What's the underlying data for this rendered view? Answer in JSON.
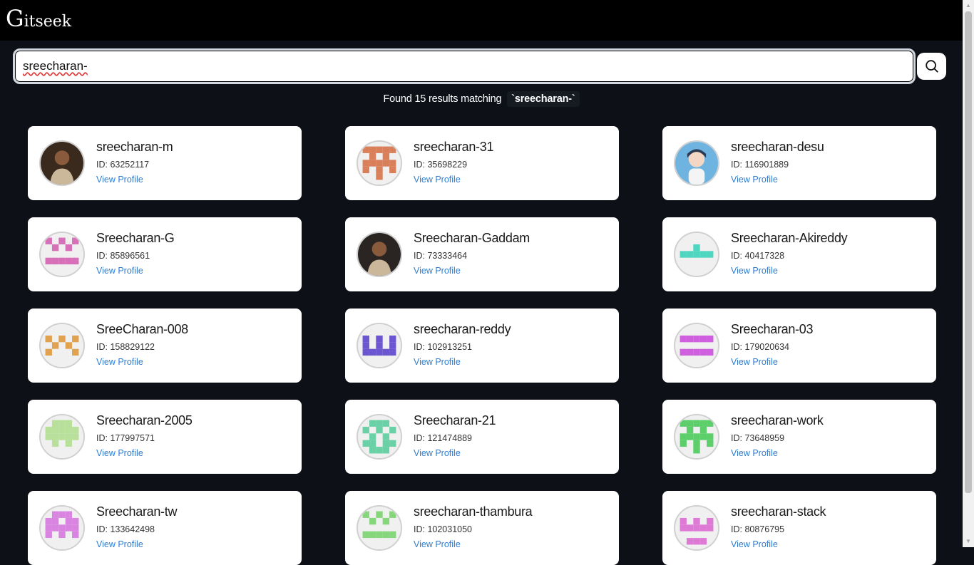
{
  "app": {
    "logo_initial": "G",
    "logo_rest": "itseek"
  },
  "search": {
    "value": "sreecharan-",
    "button_icon": "search-icon"
  },
  "results": {
    "prefix": "Found 15 results matching",
    "query": "`sreecharan-`"
  },
  "labels": {
    "view_profile": "View Profile"
  },
  "users": [
    {
      "name": "sreecharan-m",
      "id": "ID: 63252117",
      "avatar": "photo",
      "color": "#3a2a1e"
    },
    {
      "name": "sreecharan-31",
      "id": "ID: 35698229",
      "avatar": "identicon",
      "color": "#d9805a"
    },
    {
      "name": "sreecharan-desu",
      "id": "ID: 116901889",
      "avatar": "anime",
      "color": "#6fb4e0"
    },
    {
      "name": "Sreecharan-G",
      "id": "ID: 85896561",
      "avatar": "identicon",
      "color": "#d770b8"
    },
    {
      "name": "Sreecharan-Gaddam",
      "id": "ID: 73333464",
      "avatar": "photo",
      "color": "#2a2522"
    },
    {
      "name": "Sreecharan-Akireddy",
      "id": "ID: 40417328",
      "avatar": "identicon",
      "color": "#4fd6c1"
    },
    {
      "name": "SreeCharan-008",
      "id": "ID: 158829122",
      "avatar": "identicon",
      "color": "#e0a24e"
    },
    {
      "name": "sreecharan-reddy",
      "id": "ID: 102913251",
      "avatar": "identicon",
      "color": "#6b55d1"
    },
    {
      "name": "Sreecharan-03",
      "id": "ID: 179020634",
      "avatar": "identicon",
      "color": "#d05fe0"
    },
    {
      "name": "Sreecharan-2005",
      "id": "ID: 177997571",
      "avatar": "identicon",
      "color": "#b8e09a"
    },
    {
      "name": "Sreecharan-21",
      "id": "ID: 121474889",
      "avatar": "identicon",
      "color": "#6ad0a6"
    },
    {
      "name": "sreecharan-work",
      "id": "ID: 73648959",
      "avatar": "identicon",
      "color": "#5ccf6a"
    },
    {
      "name": "Sreecharan-tw",
      "id": "ID: 133642498",
      "avatar": "identicon",
      "color": "#d984e0"
    },
    {
      "name": "sreecharan-thambura",
      "id": "ID: 102031050",
      "avatar": "identicon",
      "color": "#86d67c"
    },
    {
      "name": "sreecharan-stack",
      "id": "ID: 80876795",
      "avatar": "identicon",
      "color": "#de7ad6"
    }
  ]
}
